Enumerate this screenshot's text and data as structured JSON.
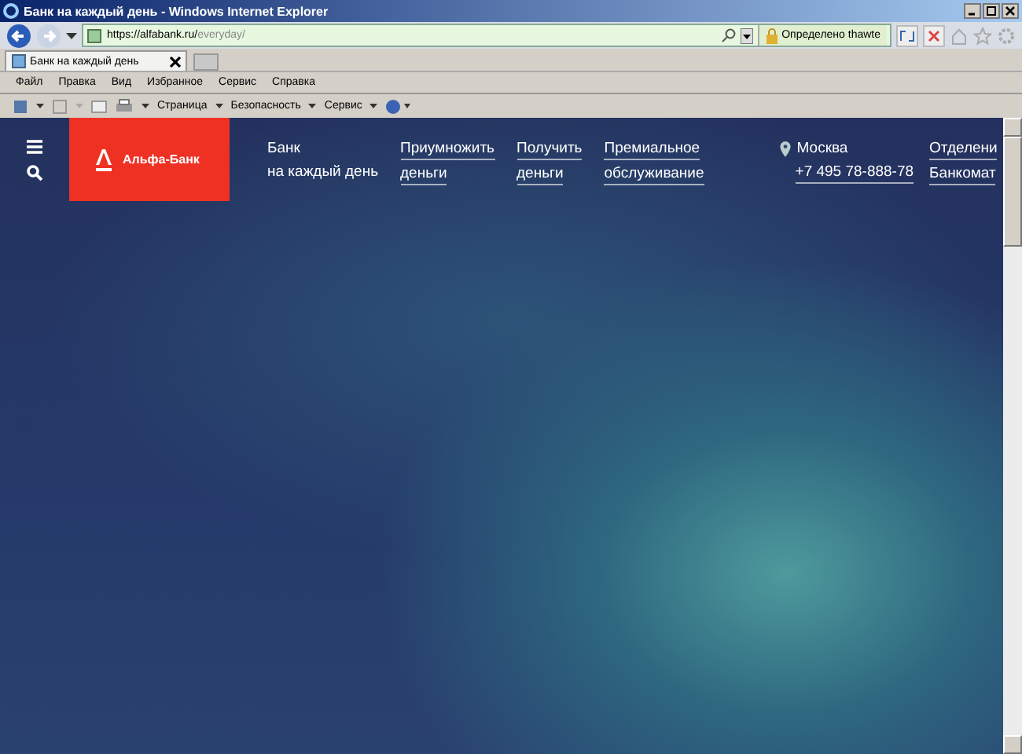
{
  "window": {
    "title": "Банк на каждый день - Windows Internet Explorer"
  },
  "address_bar": {
    "url_host": "https://alfabank.ru/",
    "url_path": "everyday/",
    "certificate": "Определено thawte"
  },
  "tabs": [
    {
      "label": "Банк на каждый день",
      "selected": true
    }
  ],
  "menu": [
    "Файл",
    "Правка",
    "Вид",
    "Избранное",
    "Сервис",
    "Справка"
  ],
  "command_bar": [
    "Страница",
    "Безопасность",
    "Сервис"
  ],
  "site": {
    "logo": "Альфа-Банк",
    "nav": [
      {
        "line1": "Банк",
        "line2": "на каждый день",
        "underlined": false
      },
      {
        "line1": "Приумножить",
        "line2": "деньги",
        "underlined": true
      },
      {
        "line1": "Получить",
        "line2": "деньги",
        "underlined": true
      },
      {
        "line1": "Премиальное",
        "line2": "обслуживание",
        "underlined": true
      }
    ],
    "city": "Москва",
    "phone": "+7 495 78-888-78",
    "links": [
      "Отделени",
      "Банкомат"
    ]
  }
}
